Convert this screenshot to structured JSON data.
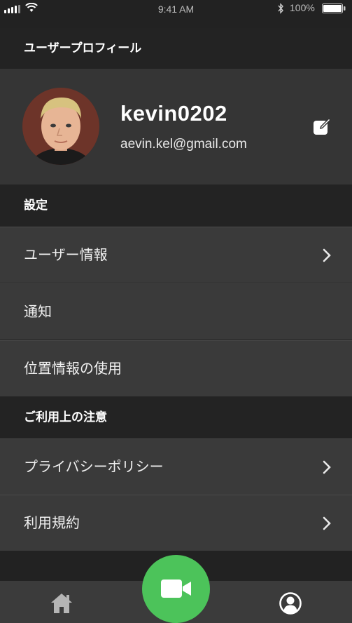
{
  "status_bar": {
    "time": "9:41 AM",
    "battery": "100%"
  },
  "profile": {
    "header": "ユーザープロフィール",
    "username": "kevin0202",
    "email": "aevin.kel@gmail.com"
  },
  "settings": {
    "header": "設定",
    "items": [
      {
        "label": "ユーザー情報"
      },
      {
        "label": "通知"
      },
      {
        "label": "位置情報の使用"
      }
    ]
  },
  "notes": {
    "header": "ご利用上の注意",
    "items": [
      {
        "label": "プライバシーポリシー"
      },
      {
        "label": "利用規約"
      }
    ]
  },
  "colors": {
    "accent": "#4cc35a",
    "background": "#222222",
    "row": "#3a3a3a"
  },
  "icons": [
    "signal-icon",
    "wifi-icon",
    "bluetooth-icon",
    "battery-icon",
    "edit-icon",
    "chevron-right-icon",
    "home-icon",
    "video-camera-icon",
    "user-circle-icon"
  ]
}
